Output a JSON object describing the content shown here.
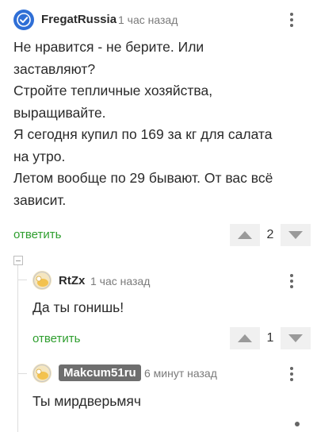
{
  "comments": [
    {
      "author": "FregatRussia",
      "time": "1 час назад",
      "lines": [
        "Не нравится - не берите. Или",
        "заставляют?",
        "Стройте тепличные хозяйства,",
        "выращивайте.",
        "Я сегодня купил по 169 за кг для салата",
        "на утро.",
        "Летом вообще по 29 бывают. От вас всё",
        "зависит."
      ],
      "reply_label": "ответить",
      "votes": "2",
      "avatar_icon": "verified-check-icon"
    },
    {
      "author": "RtZx",
      "time": "1 час назад",
      "text": "Да ты гонишь!",
      "reply_label": "ответить",
      "votes": "1",
      "avatar_icon": "default-avatar-icon"
    },
    {
      "author": "Makcum51ru",
      "time": "6 минут назад",
      "text": "Ты мирдверьмяч",
      "avatar_icon": "default-avatar-icon"
    }
  ],
  "colors": {
    "reply_link": "#2e9e2e",
    "verified_badge": "#2f6fd6",
    "author_badge_bg": "#6e6e6e"
  }
}
